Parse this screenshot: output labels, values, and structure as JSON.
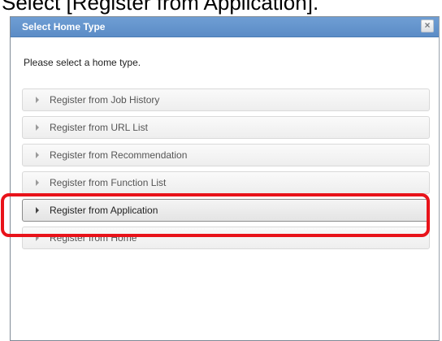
{
  "caption": "Select [Register from Application].",
  "dialog": {
    "title": "Select Home Type",
    "close_glyph": "×",
    "close_icon": "close-icon",
    "instruction": "Please select a home type.",
    "options": [
      {
        "label": "Register from Job History"
      },
      {
        "label": "Register from URL List"
      },
      {
        "label": "Register from Recommendation"
      },
      {
        "label": "Register from Function List"
      },
      {
        "label": "Register from Application",
        "selected": true
      },
      {
        "label": "Register from Home"
      }
    ],
    "expand_icon": "caret-right-icon"
  },
  "colors": {
    "header": "#5b8cc6",
    "highlight": "#e8131a",
    "option_border": "#d9d9d9"
  }
}
